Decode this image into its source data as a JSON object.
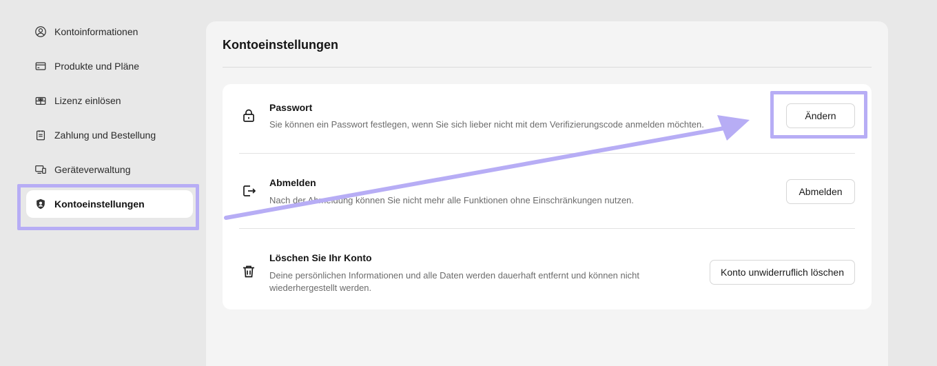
{
  "sidebar": {
    "items": [
      {
        "label": "Kontoinformationen",
        "icon": "user-circle-icon"
      },
      {
        "label": "Produkte und Pläne",
        "icon": "card-icon"
      },
      {
        "label": "Lizenz einlösen",
        "icon": "gift-icon"
      },
      {
        "label": "Zahlung und Bestellung",
        "icon": "clipboard-icon"
      },
      {
        "label": "Geräteverwaltung",
        "icon": "devices-icon"
      },
      {
        "label": "Kontoeinstellungen",
        "icon": "shield-user-icon",
        "active": true
      }
    ]
  },
  "main": {
    "title": "Kontoeinstellungen",
    "rows": [
      {
        "title": "Passwort",
        "description": "Sie können ein Passwort festlegen, wenn Sie sich lieber nicht mit dem Verifizierungscode anmelden möchten.",
        "button": "Ändern",
        "icon": "lock-icon"
      },
      {
        "title": "Abmelden",
        "description": "Nach der Abmeldung können Sie nicht mehr alle Funktionen ohne Einschränkungen nutzen.",
        "button": "Abmelden",
        "icon": "logout-icon"
      },
      {
        "title": "Löschen Sie Ihr Konto",
        "description_line1": "Deine persönlichen Informationen und alle Daten werden dauerhaft entfernt und können nicht",
        "description_line2": "wiederhergestellt werden.",
        "button": "Konto unwiderruflich löschen",
        "icon": "trash-icon"
      }
    ]
  },
  "annotations": {
    "highlight_color": "#b7adf5",
    "arrow_color": "#b7adf5"
  }
}
